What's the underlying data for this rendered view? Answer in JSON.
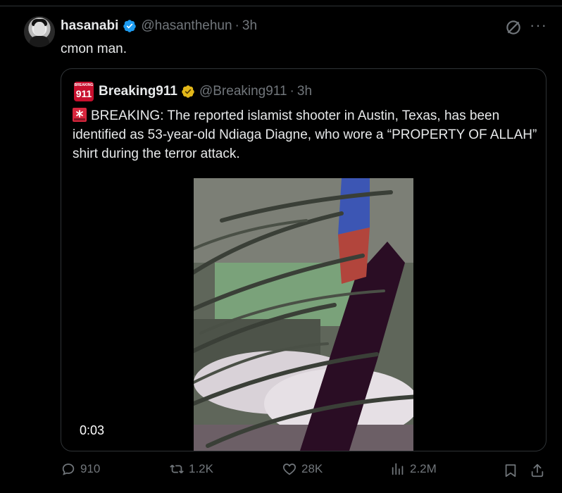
{
  "tweet": {
    "author_name": "hasanabi",
    "author_handle": "@hasanthehun",
    "separator": "·",
    "time": "3h",
    "text": "cmon man."
  },
  "quote": {
    "author_name": "Breaking911",
    "author_handle": "@Breaking911",
    "separator": "·",
    "time": "3h",
    "avatar_top": "BREAKING",
    "avatar_num": "911",
    "text": "BREAKING: The reported islamist shooter in Austin, Texas, has been identified as 53-year-old Ndiaga Diagne, who wore a “PROPERTY OF ALLAH” shirt during the terror attack.",
    "video_time": "0:03"
  },
  "actions": {
    "replies": "910",
    "reposts": "1.2K",
    "likes": "28K",
    "views": "2.2M"
  },
  "colors": {
    "background": "#000000",
    "text": "#e7e9ea",
    "muted": "#71767b",
    "border": "#2f3336",
    "verified_blue": "#1d9bf0",
    "verified_gold": "#e2b719"
  }
}
